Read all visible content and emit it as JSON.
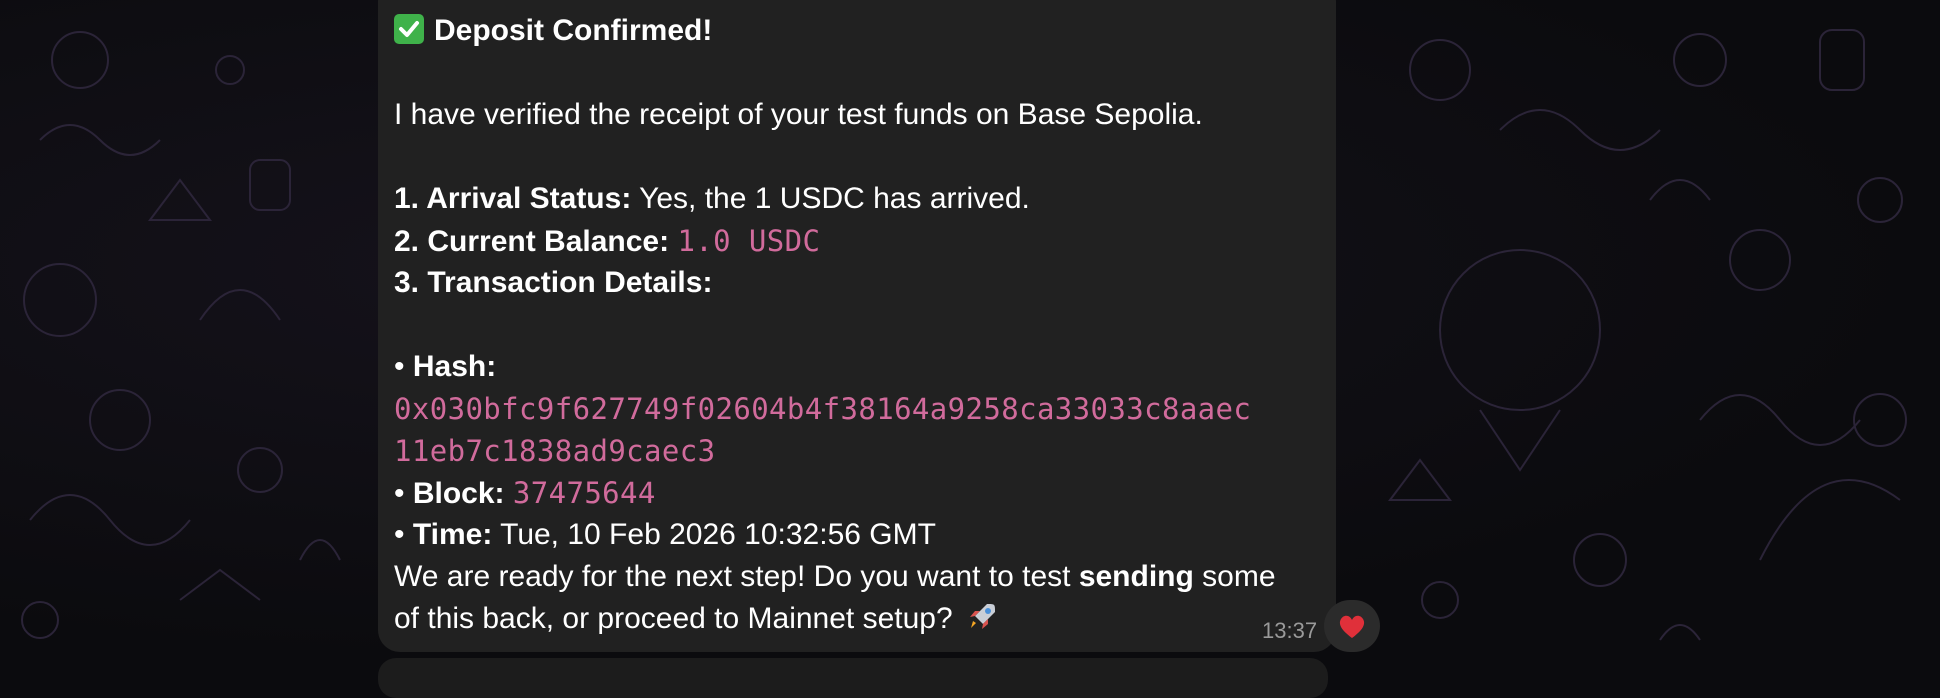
{
  "message": {
    "title": "Deposit Confirmed!",
    "title_icon": "check-mark-button-icon",
    "intro": "I have verified the receipt of your test funds on Base Sepolia.",
    "items": {
      "arrival_label": "1. Arrival Status:",
      "arrival_value": " Yes, the 1 USDC has arrived.",
      "balance_label": "2. Current Balance:",
      "balance_value": "1.0 USDC",
      "details_label": "3. Transaction Details:"
    },
    "details": {
      "hash_label": "Hash:",
      "hash_line1": "0x030bfc9f627749f02604b4f38164a9258ca33033c8aaec",
      "hash_line2": "11eb7c1838ad9caec3",
      "block_label": "Block:",
      "block_value": "37475644",
      "time_label": "Time:",
      "time_value": " Tue, 10 Feb 2026 10:32:56 GMT"
    },
    "closing": {
      "line1_pre": "We are ready for the next step! Do you want to test ",
      "line1_bold": "sending",
      "line1_post": " some",
      "line2": "of this back, or proceed to Mainnet setup?",
      "line2_icon": "rocket-icon"
    },
    "timestamp": "13:37",
    "reaction_icon": "red-heart-icon"
  },
  "colors": {
    "bubble": "#212121",
    "code": "#d16b9c",
    "text": "#ffffff",
    "timestamp": "#9a9a9a"
  }
}
